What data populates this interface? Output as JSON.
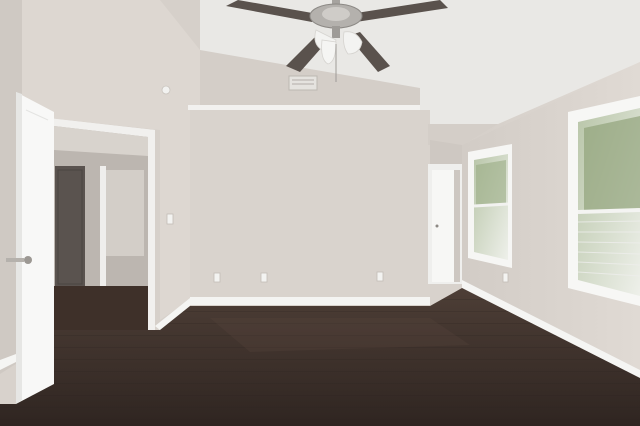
{
  "scene": {
    "palette": {
      "ceiling": "#ecebea",
      "wall_light": "#ddd7d1",
      "wall_back": "#d9d3cd",
      "wall_shadow": "#c9c3bd",
      "trim": "#f7f7f5",
      "floor_dark": "#3a2e29",
      "floor_mid": "#4a3b34",
      "fan_metal": "#a9a6a2",
      "fan_blade": "#5b534e",
      "window_glass": "#d7ddd2",
      "foliage": "#8f9f7a"
    },
    "icons": {
      "ceiling_fan": "ceiling-fan-icon",
      "door_handle": "door-handle-icon",
      "outlet": "outlet-icon",
      "vent": "vent-icon",
      "switch": "light-switch-icon"
    }
  }
}
